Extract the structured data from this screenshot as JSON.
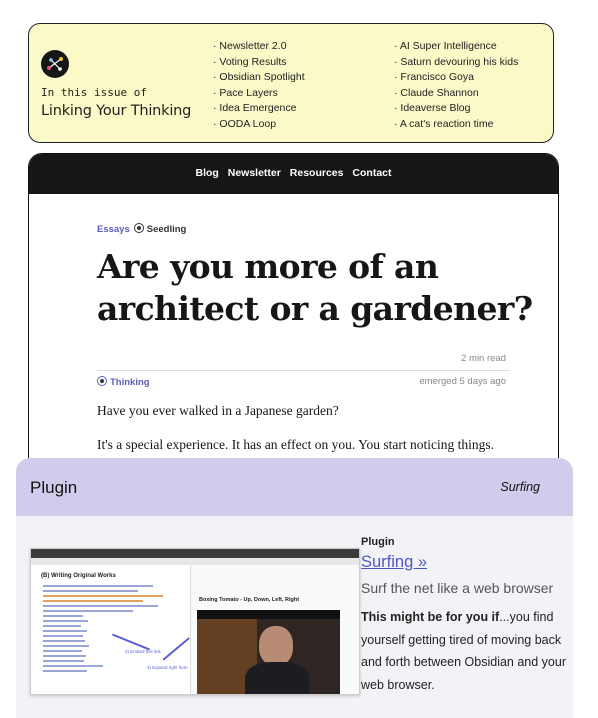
{
  "newsletter": {
    "issue_label": "In this issue of",
    "title": "Linking Your Thinking",
    "topics_col1": [
      "Newsletter 2.0",
      "Voting Results",
      "Obsidian Spotlight",
      "Pace Layers",
      "Idea Emergence",
      "OODA Loop"
    ],
    "topics_col2": [
      "AI Super Intelligence",
      "Saturn devouring his kids",
      "Francisco Goya",
      "Claude Shannon",
      "Ideaverse Blog",
      "A cat's reaction time"
    ]
  },
  "article": {
    "nav": [
      "Blog",
      "Newsletter",
      "Resources",
      "Contact"
    ],
    "tag_essays": "Essays",
    "tag_seedling": "Seedling",
    "headline": "Are you more of an architect or a gardener?",
    "read_time": "2 min read",
    "category": "Thinking",
    "emerged": "emerged 5 days ago",
    "para1": "Have you ever walked in a Japanese garden?",
    "para2": "It's a special experience. It has an effect on you. You start noticing things."
  },
  "plugin": {
    "header_title": "Plugin",
    "header_type": "Surfing",
    "label": "Plugin",
    "link": "Surfing »",
    "tagline": "Surf the net like a web browser",
    "desc_bold": "This might be for you if",
    "desc_rest": "...you find yourself getting tired of moving back and forth between Obsidian and your web browser.",
    "screenshot": {
      "note_title": "(B) Writing Original Works",
      "video_title": "Boxing Tomato - Up, Down, Left, Right",
      "anno1": "2) Embed this link",
      "anno2": "3) Expand right here"
    }
  },
  "colors": {
    "newsletter_bg": "#fbf9c8",
    "nav_bg": "#161616",
    "accent": "#5b5fb5",
    "plugin_header": "#d1cceb",
    "plugin_link": "#4b57c7"
  }
}
